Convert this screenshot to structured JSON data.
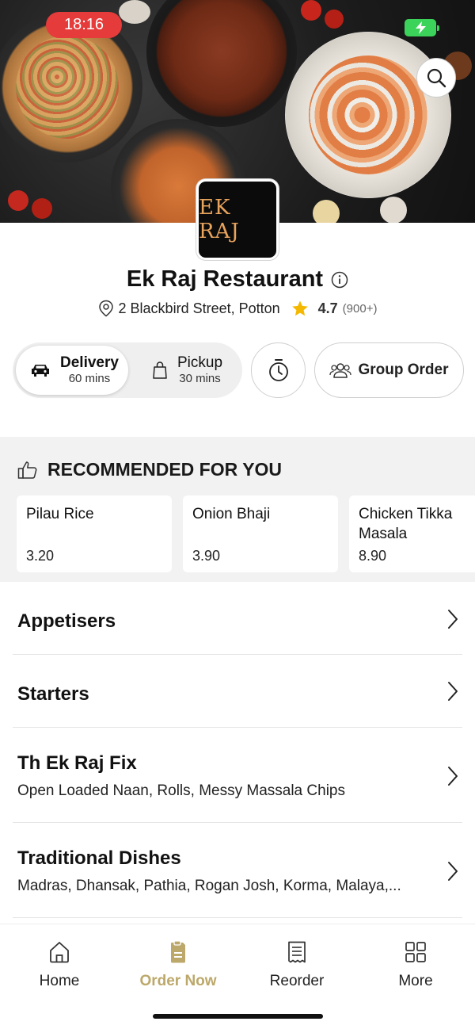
{
  "status_bar": {
    "time": "18:16"
  },
  "restaurant": {
    "logo_text": "EK RAJ",
    "name": "Ek Raj Restaurant",
    "address": "2 Blackbird Street, Potton",
    "rating": "4.7",
    "rating_count": "(900+)"
  },
  "order_mode": {
    "delivery": {
      "label": "Delivery",
      "time": "60 mins"
    },
    "pickup": {
      "label": "Pickup",
      "time": "30 mins"
    },
    "group_order_label": "Group Order"
  },
  "recommended": {
    "heading": "RECOMMENDED FOR YOU",
    "items": [
      {
        "name": "Pilau Rice",
        "price": "3.20"
      },
      {
        "name": "Onion Bhaji",
        "price": "3.90"
      },
      {
        "name": "Chicken Tikka Masala",
        "price": "8.90"
      }
    ]
  },
  "categories": [
    {
      "title": "Appetisers",
      "desc": ""
    },
    {
      "title": "Starters",
      "desc": ""
    },
    {
      "title": "Th Ek Raj Fix",
      "desc": "Open Loaded Naan, Rolls, Messy Massala Chips"
    },
    {
      "title": "Traditional Dishes",
      "desc": "Madras, Dhansak, Pathia, Rogan Josh, Korma, Malaya,..."
    }
  ],
  "nav": {
    "items": [
      {
        "label": "Home",
        "icon": "home-icon"
      },
      {
        "label": "Order Now",
        "icon": "order-icon"
      },
      {
        "label": "Reorder",
        "icon": "receipt-icon"
      },
      {
        "label": "More",
        "icon": "grid-icon"
      }
    ],
    "active_color": "#bca86a"
  },
  "colors": {
    "status_time_bg": "#e53b3b",
    "battery": "#3cd35a",
    "star": "#f5b800"
  }
}
